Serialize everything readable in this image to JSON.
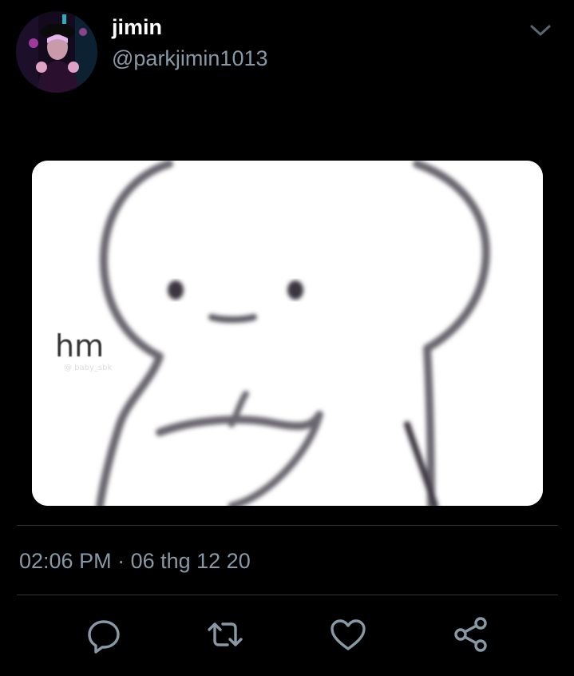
{
  "author": {
    "display_name": "jimin",
    "handle": "@parkjimin1013",
    "avatar_icon": "profile-photo"
  },
  "menu": {
    "icon": "chevron-down-icon"
  },
  "media": {
    "overlay_text": "hm",
    "background": "#ffffff"
  },
  "meta": {
    "time": "02:06 PM",
    "separator": " · ",
    "date": "06 thg 12 20"
  },
  "actions": [
    {
      "icon": "reply-icon"
    },
    {
      "icon": "retweet-icon"
    },
    {
      "icon": "like-icon"
    },
    {
      "icon": "share-icon"
    }
  ],
  "colors": {
    "background": "#000000",
    "primary_text": "#ffffff",
    "secondary_text": "#8899a6",
    "divider": "#2f3336"
  }
}
